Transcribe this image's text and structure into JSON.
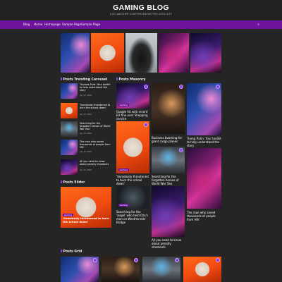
{
  "site": {
    "title": "GAMING BLOG",
    "tagline": "JUST ANOTHER CORPORATENEWS PRO SITES SITE"
  },
  "nav": {
    "items": [
      "Blog",
      "Home",
      "Homepage",
      "Sample Page",
      "Sample Page"
    ],
    "search_icon": "⌕"
  },
  "trending": {
    "title": "Posts Trending Carousel",
    "items": [
      {
        "title": "Thumbs Pulls: Your toolkit to help understand the story",
        "date": "July 15, 2019"
      },
      {
        "title": "'Somebody threatened to burn the school down'",
        "date": "July 15, 2019"
      },
      {
        "title": "Searching for the forgotten heroes of World War Two",
        "date": "July 15, 2019"
      },
      {
        "title": "The man who saved thousands of people from HIV",
        "date": "July 15, 2019"
      },
      {
        "title": "All you need to know about penalty shootouts",
        "date": "July 15, 2019"
      }
    ]
  },
  "slider": {
    "title": "Posts Slider",
    "category": "Gaming",
    "post_title": "'Somebody threatened to burn the school down'"
  },
  "masonry": {
    "title": "Posts Masonry",
    "category": "Gaming",
    "posts": [
      {
        "title": "Google hit with record EU fine over Shopping service"
      },
      {
        "title": "'Somebody threatened to burn the school down'"
      },
      {
        "title": "Searching for the 'angel' who held Oza's man on Westminster Bridge"
      },
      {
        "title": "Business booming for giant cargo planes"
      },
      {
        "title": "Searching for the forgotten heroes of World War Two"
      },
      {
        "title": "All you need to know about penalty shootouts"
      },
      {
        "title": "Trump Putin: Your toolkit to help understand the story"
      },
      {
        "title": "The man who saved thousands of people from HIV"
      }
    ]
  },
  "grid": {
    "title": "Posts Grid"
  },
  "colors": {
    "nav": "#6e139c",
    "accent": "#8a3fe0",
    "background": "#252525"
  }
}
